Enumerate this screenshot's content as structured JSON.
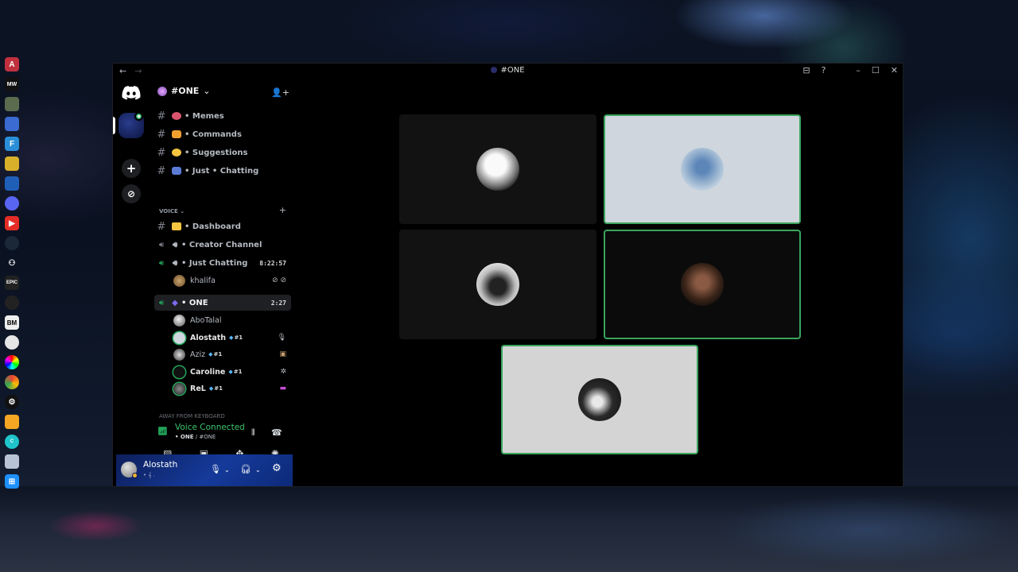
{
  "window": {
    "title": "#ONE",
    "nav": {
      "back": "←",
      "forward": "→"
    },
    "controls": {
      "inbox_icon": "inbox-icon",
      "help_icon": "help-icon",
      "minimize": "–",
      "maximize": "☐",
      "close": "✕"
    }
  },
  "server": {
    "name": "#ONE",
    "chevron": "⌄",
    "invite_icon": "add-member-icon"
  },
  "channels": [
    {
      "name": "• Memes",
      "type": "text",
      "emoji_color": "#d8546e"
    },
    {
      "name": "• Commands",
      "type": "text",
      "emoji_color": "#f0a030"
    },
    {
      "name": "• Suggestions",
      "type": "text",
      "emoji_color": "#f5c542"
    },
    {
      "name": "• Just • Chatting",
      "type": "text",
      "emoji_color": "#5a7ad6"
    }
  ],
  "voice_category": {
    "label": "VOICE",
    "chevron": "⌄",
    "add": "+"
  },
  "voice_channels": [
    {
      "name": "• Dashboard",
      "type": "text",
      "emoji_color": "#f5c542"
    },
    {
      "name": "•  Creator Channel",
      "type": "voice"
    },
    {
      "name": "• Just Chatting",
      "type": "voice",
      "time": "8:22:57"
    },
    {
      "name": "• ONE",
      "type": "voice",
      "time": "2:27"
    }
  ],
  "voice_users_just_chatting": [
    {
      "name": "khalifa",
      "icons": "muted-deafened-icon"
    }
  ],
  "voice_users_one": [
    {
      "name": "AboTalal",
      "tag": "",
      "icon": ""
    },
    {
      "name": "Alostath",
      "tag": "#1",
      "icon": "🎙"
    },
    {
      "name": "Aziz",
      "tag": "#1",
      "icon": "▣"
    },
    {
      "name": "Caroline",
      "tag": "#1",
      "icon": "✲"
    },
    {
      "name": "ReL",
      "tag": "#1",
      "icon": "▬"
    }
  ],
  "afk_category": {
    "label": "AWAY FROM KEYBOARD",
    "add": "+"
  },
  "voice_panel": {
    "status": "Voice Connected",
    "location_bold": "• ONE",
    "location_rest": " / #ONE",
    "icons": [
      "noise-suppression-icon",
      "disconnect-icon",
      "camera-off-icon",
      "screen-share-icon",
      "activities-icon",
      "soundboard-icon"
    ]
  },
  "user_panel": {
    "username": "Alostath",
    "status_line": "• 𝄞 ."
  },
  "stage_tiles": [
    {
      "name": "tile-1",
      "bg": "#121212",
      "avatar": "#d9d9d9",
      "speaking": false
    },
    {
      "name": "tile-2",
      "bg": "#cfd6de",
      "avatar": "#9fb6cc",
      "speaking": true
    },
    {
      "name": "tile-3",
      "bg": "#121212",
      "avatar": "#cfcfcf",
      "speaking": false
    },
    {
      "name": "tile-4",
      "bg": "#0b0b0b",
      "avatar": "#5a3b2c",
      "speaking": true
    },
    {
      "name": "tile-5",
      "bg": "#d4d4d4",
      "avatar": "#2a2a2a",
      "speaking": true
    }
  ],
  "colors": {
    "accent_green": "#23a55a",
    "speaking_border": "#3ba55d"
  }
}
